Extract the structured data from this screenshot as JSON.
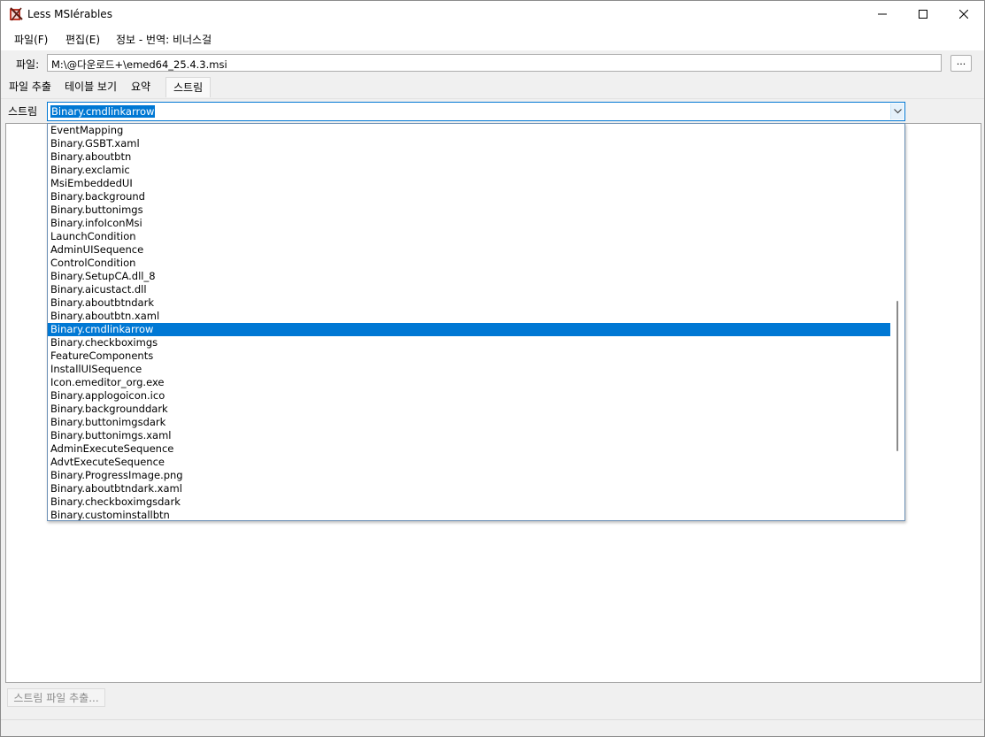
{
  "window": {
    "title": "Less MSIérables"
  },
  "menu": [
    {
      "label": "파일(F)"
    },
    {
      "label": "편집(E)"
    },
    {
      "label": "정보 - 번역: 비너스걸"
    }
  ],
  "file": {
    "label": "파일:",
    "path": "M:\\@다운로드+\\emed64_25.4.3.msi",
    "browse_label": "..."
  },
  "tabs": [
    {
      "label": "파일 추출"
    },
    {
      "label": "테이블 보기"
    },
    {
      "label": "요약"
    },
    {
      "label": "스트림"
    }
  ],
  "stream": {
    "label": "스트림",
    "selected": "Binary.cmdlinkarrow",
    "items": [
      "EventMapping",
      "Binary.GSBT.xaml",
      "Binary.aboutbtn",
      "Binary.exclamic",
      "MsiEmbeddedUI",
      "Binary.background",
      "Binary.buttonimgs",
      "Binary.infoIconMsi",
      "LaunchCondition",
      "AdminUISequence",
      "ControlCondition",
      "Binary.SetupCA.dll_8",
      "Binary.aicustact.dll",
      "Binary.aboutbtndark",
      "Binary.aboutbtn.xaml",
      "Binary.cmdlinkarrow",
      "Binary.checkboximgs",
      "FeatureComponents",
      "InstallUISequence",
      "Icon.emeditor_org.exe",
      "Binary.applogoicon.ico",
      "Binary.backgrounddark",
      "Binary.buttonimgsdark",
      "Binary.buttonimgs.xaml",
      "AdminExecuteSequence",
      "AdvtExecuteSequence",
      "Binary.ProgressImage.png",
      "Binary.aboutbtndark.xaml",
      "Binary.checkboximgsdark",
      "Binary.custominstallbtn"
    ]
  },
  "extract_button": {
    "label": "스트림 파일 추출..."
  },
  "icons": {
    "app": "app-icon",
    "minimize": "minimize-icon",
    "maximize": "maximize-icon",
    "close": "close-icon",
    "dropdown": "chevron-down-icon"
  },
  "colors": {
    "selection": "#0078d4"
  }
}
